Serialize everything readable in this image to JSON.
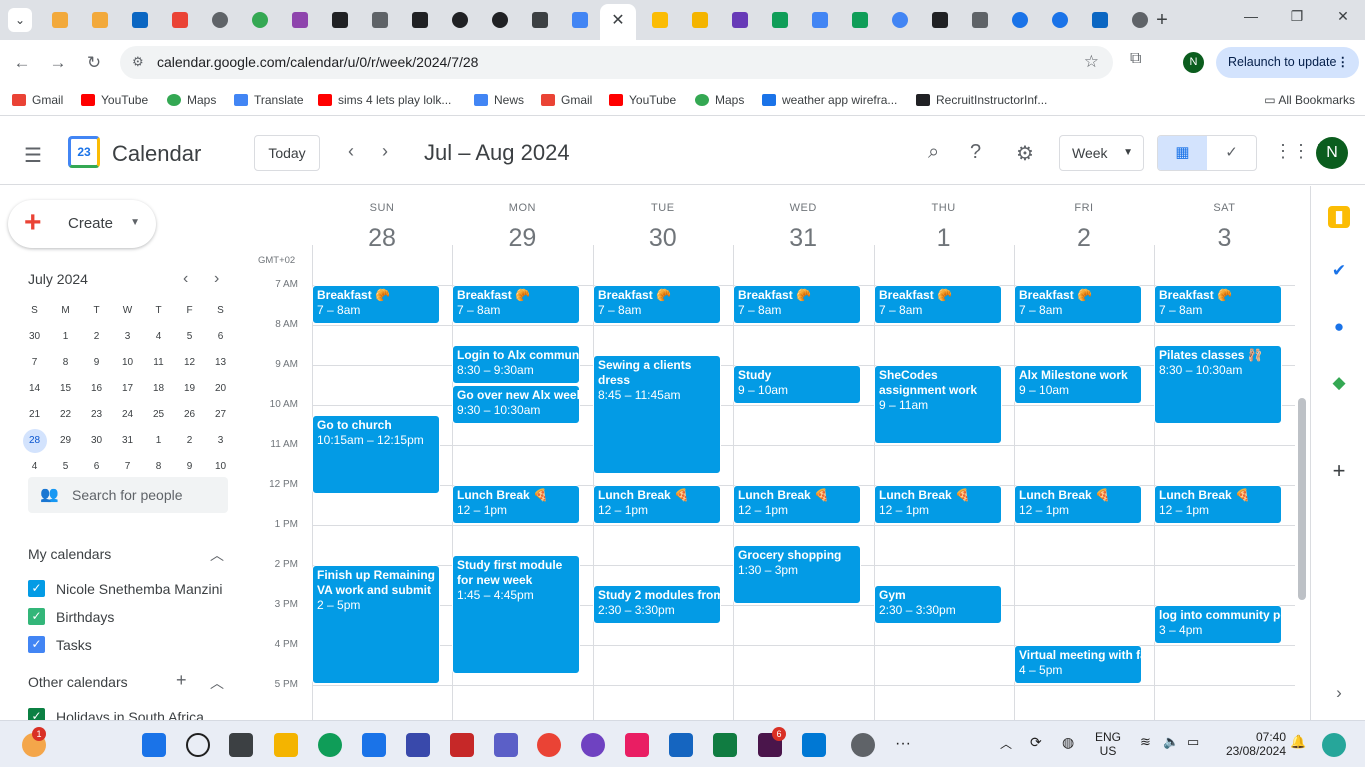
{
  "browser": {
    "url": "calendar.google.com/calendar/u/0/r/week/2024/7/28",
    "relaunch_label": "Relaunch to update",
    "profile_initial": "N",
    "bookmarks": [
      "Gmail",
      "YouTube",
      "Maps",
      "Translate",
      "sims 4 lets play lolk...",
      "News",
      "Gmail",
      "YouTube",
      "Maps",
      "weather app wirefra...",
      "RecruitInstructorInf..."
    ],
    "all_bookmarks": "All Bookmarks"
  },
  "header": {
    "app_name": "Calendar",
    "logo_day": "23",
    "today_label": "Today",
    "date_range": "Jul – Aug 2024",
    "view_label": "Week",
    "avatar_initial": "N"
  },
  "sidebar": {
    "create_label": "Create",
    "mini_month": "July 2024",
    "weekday_initials": [
      "S",
      "M",
      "T",
      "W",
      "T",
      "F",
      "S"
    ],
    "mini_days": [
      "30",
      "1",
      "2",
      "3",
      "4",
      "5",
      "6",
      "7",
      "8",
      "9",
      "10",
      "11",
      "12",
      "13",
      "14",
      "15",
      "16",
      "17",
      "18",
      "19",
      "20",
      "21",
      "22",
      "23",
      "24",
      "25",
      "26",
      "27",
      "28",
      "29",
      "30",
      "31",
      "1",
      "2",
      "3",
      "4",
      "5",
      "6",
      "7",
      "8",
      "9",
      "10"
    ],
    "search_people": "Search for people",
    "my_calendars_label": "My calendars",
    "my_calendars": [
      {
        "name": "Nicole Snethemba Manzini",
        "color": "#039be5"
      },
      {
        "name": "Birthdays",
        "color": "#33b679"
      },
      {
        "name": "Tasks",
        "color": "#4285f4"
      }
    ],
    "other_calendars_label": "Other calendars",
    "other_calendars": [
      {
        "name": "Holidays in South Africa",
        "color": "#0b8043"
      }
    ]
  },
  "week": {
    "timezone": "GMT+02",
    "days": [
      {
        "name": "SUN",
        "date": "28"
      },
      {
        "name": "MON",
        "date": "29"
      },
      {
        "name": "TUE",
        "date": "30"
      },
      {
        "name": "WED",
        "date": "31"
      },
      {
        "name": "THU",
        "date": "1"
      },
      {
        "name": "FRI",
        "date": "2"
      },
      {
        "name": "SAT",
        "date": "3"
      }
    ],
    "hours": [
      "7 AM",
      "8 AM",
      "9 AM",
      "10 AM",
      "11 AM",
      "12 PM",
      "1 PM",
      "2 PM",
      "3 PM",
      "4 PM",
      "5 PM"
    ],
    "events": [
      {
        "day": 0,
        "start": 7,
        "end": 8,
        "title": "Breakfast 🥐",
        "time": "7 – 8am"
      },
      {
        "day": 1,
        "start": 7,
        "end": 8,
        "title": "Breakfast 🥐",
        "time": "7 – 8am"
      },
      {
        "day": 2,
        "start": 7,
        "end": 8,
        "title": "Breakfast 🥐",
        "time": "7 – 8am"
      },
      {
        "day": 3,
        "start": 7,
        "end": 8,
        "title": "Breakfast 🥐",
        "time": "7 – 8am"
      },
      {
        "day": 4,
        "start": 7,
        "end": 8,
        "title": "Breakfast 🥐",
        "time": "7 – 8am"
      },
      {
        "day": 5,
        "start": 7,
        "end": 8,
        "title": "Breakfast 🥐",
        "time": "7 – 8am"
      },
      {
        "day": 6,
        "start": 7,
        "end": 8,
        "title": "Breakfast 🥐",
        "time": "7 – 8am"
      },
      {
        "day": 1,
        "start": 8.5,
        "end": 9.5,
        "title": "Login to Alx community",
        "time": "8:30 – 9:30am"
      },
      {
        "day": 1,
        "start": 9.5,
        "end": 10.5,
        "title": "Go over new Alx week",
        "time": "9:30 – 10:30am"
      },
      {
        "day": 2,
        "start": 8.75,
        "end": 11.75,
        "title": "Sewing a clients dress",
        "time": "8:45 – 11:45am"
      },
      {
        "day": 3,
        "start": 9,
        "end": 10,
        "title": "Study",
        "time": "9 – 10am"
      },
      {
        "day": 4,
        "start": 9,
        "end": 11,
        "title": "SheCodes assignment work",
        "time": "9 – 11am"
      },
      {
        "day": 5,
        "start": 9,
        "end": 10,
        "title": "Alx Milestone work",
        "time": "9 – 10am"
      },
      {
        "day": 6,
        "start": 8.5,
        "end": 10.5,
        "title": "Pilates classes 🩰",
        "time": "8:30 – 10:30am"
      },
      {
        "day": 0,
        "start": 10.25,
        "end": 12.25,
        "title": "Go to church",
        "time": "10:15am – 12:15pm"
      },
      {
        "day": 1,
        "start": 12,
        "end": 13,
        "title": "Lunch Break 🍕",
        "time": "12 – 1pm"
      },
      {
        "day": 2,
        "start": 12,
        "end": 13,
        "title": "Lunch Break 🍕",
        "time": "12 – 1pm"
      },
      {
        "day": 3,
        "start": 12,
        "end": 13,
        "title": "Lunch Break 🍕",
        "time": "12 – 1pm"
      },
      {
        "day": 4,
        "start": 12,
        "end": 13,
        "title": "Lunch Break 🍕",
        "time": "12 – 1pm"
      },
      {
        "day": 5,
        "start": 12,
        "end": 13,
        "title": "Lunch Break 🍕",
        "time": "12 – 1pm"
      },
      {
        "day": 6,
        "start": 12,
        "end": 13,
        "title": "Lunch Break 🍕",
        "time": "12 – 1pm"
      },
      {
        "day": 3,
        "start": 13.5,
        "end": 15,
        "title": "Grocery shopping",
        "time": "1:30 – 3pm"
      },
      {
        "day": 0,
        "start": 14,
        "end": 17,
        "title": "Finish up Remaining VA work and submit",
        "time": "2 – 5pm"
      },
      {
        "day": 1,
        "start": 13.75,
        "end": 16.75,
        "title": "Study first module for new week",
        "time": "1:45 – 4:45pm"
      },
      {
        "day": 2,
        "start": 14.5,
        "end": 15.5,
        "title": "Study 2 modules from",
        "time": "2:30 – 3:30pm"
      },
      {
        "day": 4,
        "start": 14.5,
        "end": 15.5,
        "title": "Gym",
        "time": "2:30 – 3:30pm"
      },
      {
        "day": 6,
        "start": 15,
        "end": 16,
        "title": "log into community portal",
        "time": "3 – 4pm"
      },
      {
        "day": 5,
        "start": 16,
        "end": 17,
        "title": "Virtual meeting with family",
        "time": "4 – 5pm"
      }
    ]
  },
  "taskbar": {
    "language": "ENG",
    "region": "US",
    "time": "07:40",
    "date": "23/08/2024",
    "weather_badge": "1",
    "slack_badge": "6"
  }
}
